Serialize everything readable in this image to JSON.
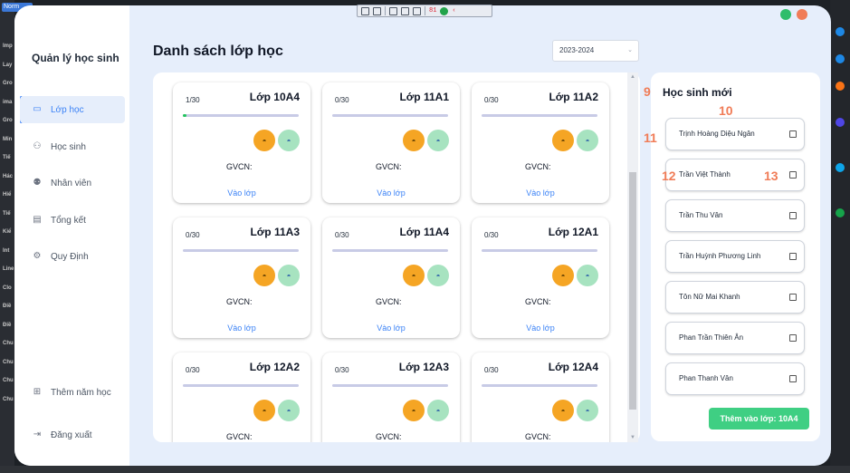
{
  "background": {
    "tab_label": "Norm",
    "left_labels": [
      "Imp",
      "Lay",
      "Gro",
      "ima",
      "Gro",
      "Min",
      "Tiế",
      "Hác",
      "Hiể",
      "Tiế",
      "Kiể",
      "Int",
      "Line",
      "Clo",
      "Điề",
      "Điề",
      "Chu",
      "Chu",
      "Chu",
      "Chu"
    ]
  },
  "toolbar": {
    "count": "81"
  },
  "app": {
    "title": "Quản lý học sinh",
    "nav": [
      {
        "label": "Lớp học",
        "icon": "classroom-icon",
        "active": true
      },
      {
        "label": "Học sinh",
        "icon": "students-icon",
        "active": false
      },
      {
        "label": "Nhân viên",
        "icon": "staff-icon",
        "active": false
      },
      {
        "label": "Tổng kết",
        "icon": "summary-icon",
        "active": false
      },
      {
        "label": "Quy Định",
        "icon": "settings-icon",
        "active": false
      }
    ],
    "bottom_nav": [
      {
        "label": "Thêm năm học",
        "icon": "add-year-icon"
      },
      {
        "label": "Đăng xuất",
        "icon": "logout-icon"
      }
    ],
    "colors": {
      "accent": "#3b82f6",
      "success": "#3fcf83",
      "close": "#f07c57",
      "minimize": "#2ebd6b"
    }
  },
  "main": {
    "title": "Danh sách lớp học",
    "year_select": {
      "value": "2023-2024"
    },
    "teacher_label": "GVCN:",
    "enter_label": "Vào lớp",
    "classes": [
      {
        "name": "Lớp 10A4",
        "count": "1/30",
        "progress": 0.0333
      },
      {
        "name": "Lớp 11A1",
        "count": "0/30",
        "progress": 0
      },
      {
        "name": "Lớp 11A2",
        "count": "0/30",
        "progress": 0
      },
      {
        "name": "Lớp 11A3",
        "count": "0/30",
        "progress": 0
      },
      {
        "name": "Lớp 11A4",
        "count": "0/30",
        "progress": 0
      },
      {
        "name": "Lớp 12A1",
        "count": "0/30",
        "progress": 0
      },
      {
        "name": "Lớp 12A2",
        "count": "0/30",
        "progress": 0
      },
      {
        "name": "Lớp 12A3",
        "count": "0/30",
        "progress": 0
      },
      {
        "name": "Lớp 12A4",
        "count": "0/30",
        "progress": 0
      }
    ]
  },
  "new_students": {
    "title": "Học sinh mới",
    "students": [
      "Trịnh Hoàng Diệu Ngân",
      "Trần Việt Thành",
      "Trần Thu Vân",
      "Trần Huỳnh Phương Linh",
      "Tôn Nữ Mai Khanh",
      "Phan Trần Thiên Ân",
      "Phan Thanh Vân"
    ],
    "add_button": "Thêm vào lớp: 10A4"
  },
  "markers": [
    "9",
    "10",
    "11",
    "12",
    "13"
  ]
}
